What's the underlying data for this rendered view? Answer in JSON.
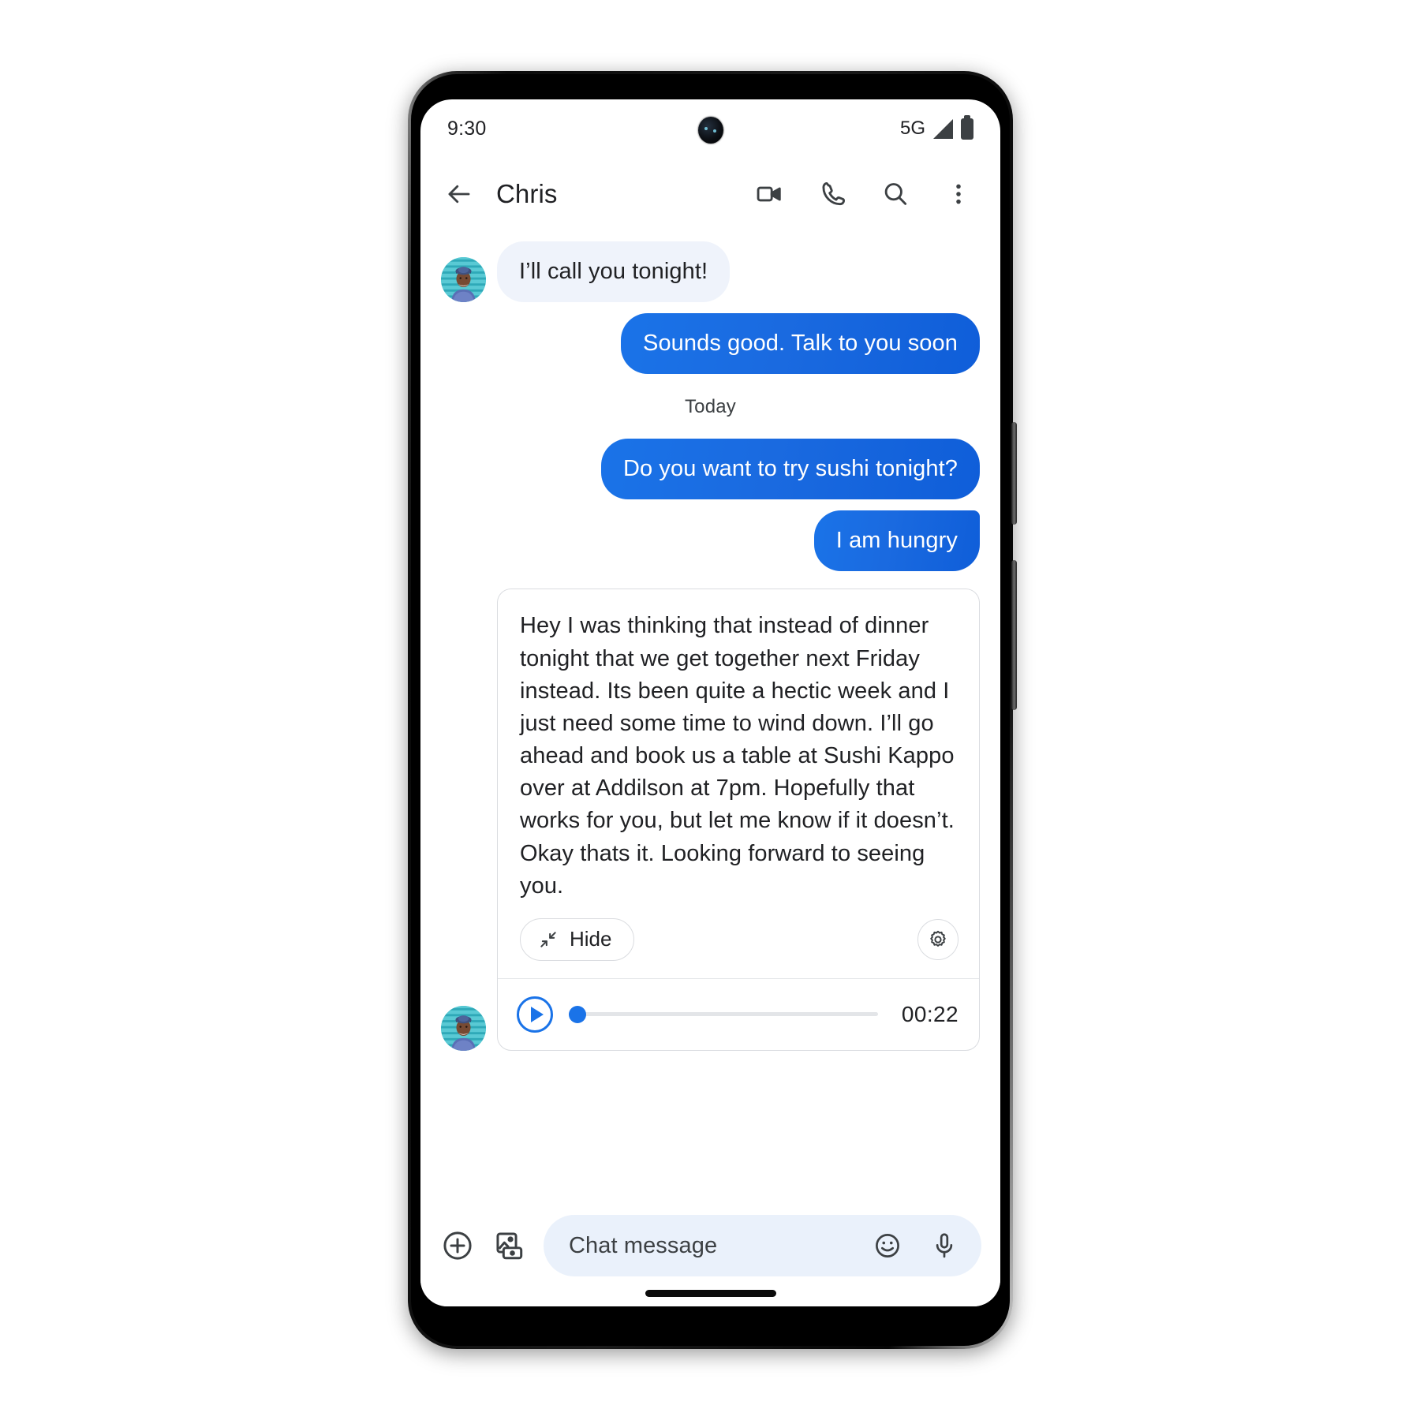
{
  "statusbar": {
    "clock": "9:30",
    "network": "5G",
    "signal_icon": "signal-bars-icon",
    "battery_icon": "battery-full-icon",
    "camera_icon": "front-camera-punch-hole"
  },
  "appbar": {
    "back_icon": "arrow-back-icon",
    "title": "Chris",
    "actions": [
      {
        "name": "video-call-button",
        "icon": "video-camera-icon"
      },
      {
        "name": "voice-call-button",
        "icon": "phone-icon"
      },
      {
        "name": "search-button",
        "icon": "search-icon"
      },
      {
        "name": "more-options-button",
        "icon": "overflow-menu-icon"
      }
    ]
  },
  "thread": {
    "day_divider": "Today",
    "messages": [
      {
        "id": "msg-1",
        "direction": "incoming",
        "text": "I’ll call you tonight!",
        "has_avatar": true
      },
      {
        "id": "msg-2",
        "direction": "outgoing",
        "text": "Sounds good. Talk to you soon"
      },
      {
        "id": "msg-3",
        "direction": "outgoing",
        "text": "Do you want to try sushi tonight?"
      },
      {
        "id": "msg-4",
        "direction": "outgoing",
        "text": "I am hungry",
        "grouped": true
      }
    ],
    "transcript_card": {
      "text": "Hey I was thinking that instead of dinner tonight that we get together next Friday instead. Its been quite a hectic week and I just need some time to wind down.  I’ll go ahead and book us a table at Sushi Kappo over at Addilson at 7pm.  Hopefully that works for you, but let me know if it doesn’t. Okay thats it. Looking forward to seeing you.",
      "hide_label": "Hide",
      "hide_icon": "collapse-arrows-icon",
      "settings_icon": "gear-icon",
      "player": {
        "play_icon": "play-circle-icon",
        "duration": "00:22",
        "progress_percent": 0
      }
    }
  },
  "composer": {
    "attach_icon": "plus-circle-icon",
    "gallery_icon": "image-camera-icon",
    "placeholder": "Chat message",
    "emoji_icon": "emoji-smiley-icon",
    "mic_icon": "microphone-icon"
  },
  "colors": {
    "accent_blue": "#1a73e8",
    "incoming_bubble": "#eff3fb",
    "composer_field": "#eaf1fb",
    "text_primary": "#202124",
    "border": "#dadce0"
  }
}
